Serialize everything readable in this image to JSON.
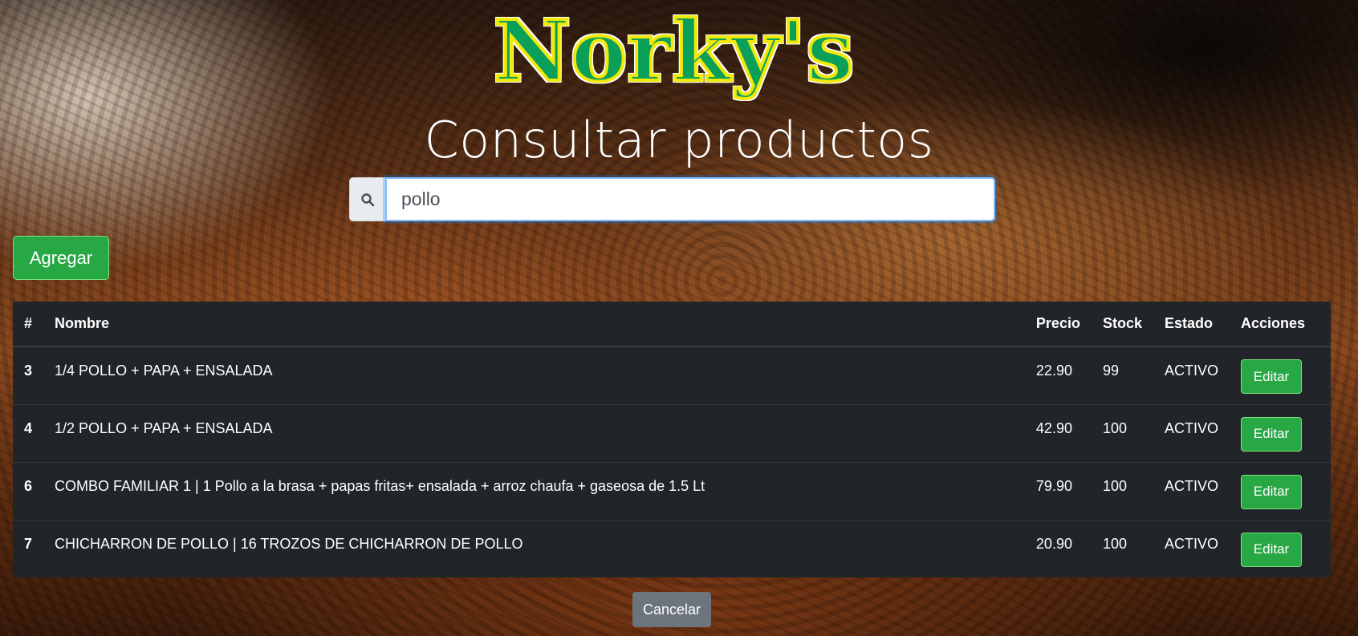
{
  "brand": {
    "logo_text": "Norky's"
  },
  "page_title": "Consultar productos",
  "search": {
    "value": "pollo",
    "icon": "search-icon"
  },
  "buttons": {
    "add": "Agregar",
    "cancel": "Cancelar"
  },
  "table": {
    "headers": [
      "#",
      "Nombre",
      "Precio",
      "Stock",
      "Estado",
      "Acciones"
    ],
    "rows": [
      {
        "id": "3",
        "nombre": "1/4 POLLO + PAPA + ENSALADA",
        "precio": "22.90",
        "stock": "99",
        "estado": "ACTIVO",
        "accion": "Editar"
      },
      {
        "id": "4",
        "nombre": "1/2 POLLO + PAPA + ENSALADA",
        "precio": "42.90",
        "stock": "100",
        "estado": "ACTIVO",
        "accion": "Editar"
      },
      {
        "id": "6",
        "nombre": "COMBO FAMILIAR 1 | 1 Pollo a la brasa + papas fritas+ ensalada + arroz chaufa + gaseosa de 1.5 Lt",
        "precio": "79.90",
        "stock": "100",
        "estado": "ACTIVO",
        "accion": "Editar"
      },
      {
        "id": "7",
        "nombre": "CHICHARRON DE POLLO | 16 TROZOS DE CHICHARRON DE POLLO",
        "precio": "20.90",
        "stock": "100",
        "estado": "ACTIVO",
        "accion": "Editar"
      }
    ]
  },
  "colors": {
    "success": "#28a745",
    "secondary": "#6c757d",
    "table_dark": "#212529"
  }
}
